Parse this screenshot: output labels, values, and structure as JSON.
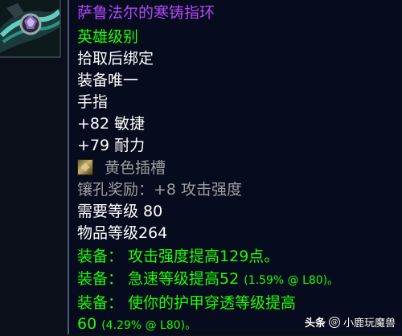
{
  "icon": {
    "name": "cold-forged-ring-icon"
  },
  "tooltip": {
    "item_name": "萨鲁法尔的寒铸指环",
    "quality": "英雄级别",
    "bind": "拾取后绑定",
    "unique": "装备唯一",
    "slot": "手指",
    "stat_agility": "+82 敏捷",
    "stat_stamina": "+79 耐力",
    "socket": "黄色插槽",
    "socket_bonus": "镶孔奖励：+8 攻击强度",
    "required_level": "需要等级 80",
    "item_level": "物品等级264",
    "equip1": "装备：  攻击强度提高129点。",
    "equip2_main": "装备：  急速等级提高52 ",
    "equip2_pct": "(1.59% @ L80)。",
    "equip3_line1": "装备：  使你的护甲穿透等级提高",
    "equip3_main": "60 ",
    "equip3_pct": "(4.29% @ L80)。"
  },
  "watermark": {
    "source": "头条",
    "author": "小鹿玩魔兽"
  },
  "colors": {
    "epic_name": "#b048f8",
    "equip_green": "#1eff00",
    "grey_text": "#9d9d9d",
    "background": "#070b1e"
  }
}
